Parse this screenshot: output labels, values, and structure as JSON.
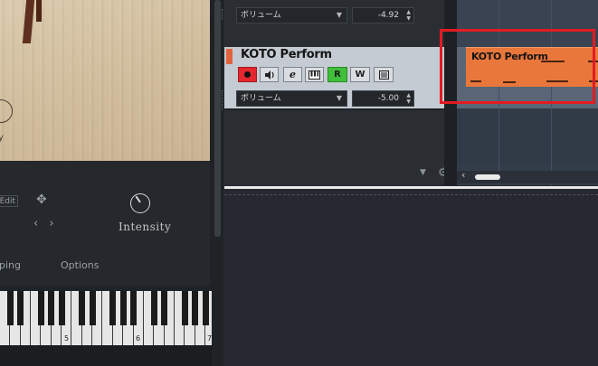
{
  "instrument": {
    "knob_label_partial": "y",
    "edit_label": "Edit",
    "intensity_label": "Intensity",
    "tab_partial": "ping",
    "options_label": "Options",
    "keyboard_octaves": [
      "5",
      "6",
      "7"
    ]
  },
  "tracks": {
    "upper_volume": {
      "label": "ボリューム",
      "value": "-4.92"
    },
    "selected_track": {
      "name": "KOTO Perform",
      "color": "#e2643f",
      "buttons": [
        "record",
        "monitor",
        "e",
        "instrument",
        "R",
        "W",
        "notepad"
      ],
      "e_label": "e",
      "r_label": "R",
      "w_label": "W"
    },
    "lower_volume": {
      "label": "ボリューム",
      "value": "-5.00"
    }
  },
  "arrangement": {
    "part_name": "KOTO Perform",
    "part_color": "#e9773b",
    "highlight_color": "#e31b23",
    "scroll_left_glyph": "‹"
  },
  "icons": {
    "dropdown": "▼",
    "spinner": "▲▼",
    "collapse": "▼",
    "settings": "⚙",
    "drag": "✥",
    "arrows": "‹ ›"
  }
}
